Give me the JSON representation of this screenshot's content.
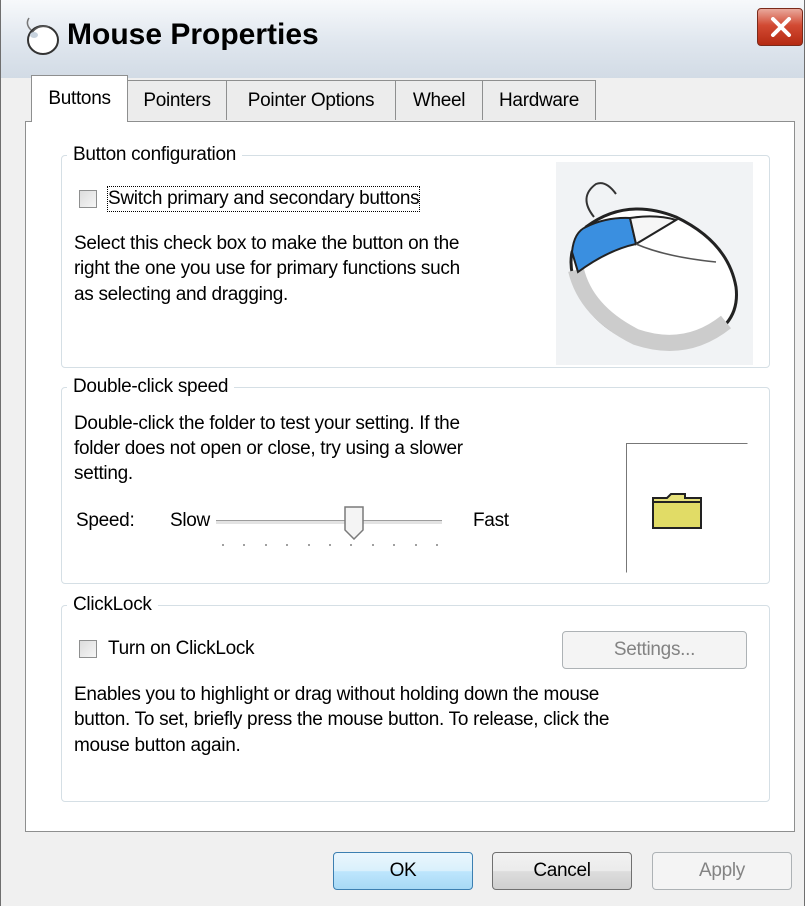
{
  "window": {
    "title": "Mouse Properties",
    "app_icon": "mouse-icon",
    "close_icon": "close-icon",
    "accent_close": "#d24a33"
  },
  "tabs": [
    {
      "label": "Buttons",
      "active": true
    },
    {
      "label": "Pointers",
      "active": false
    },
    {
      "label": "Pointer Options",
      "active": false
    },
    {
      "label": "Wheel",
      "active": false
    },
    {
      "label": "Hardware",
      "active": false
    }
  ],
  "button_config": {
    "legend": "Button configuration",
    "checkbox_label": "Switch primary and secondary buttons",
    "checked": false,
    "description_lines": [
      "Select this check box to make the button on the",
      "right the one you use for primary functions such",
      "as selecting and dragging."
    ],
    "illustration": "mouse-illustration"
  },
  "double_click": {
    "legend": "Double-click speed",
    "description_lines": [
      "Double-click the folder to test your setting. If the",
      "folder does not open or close, try using a slower",
      "setting."
    ],
    "speed_label": "Speed:",
    "slow_label": "Slow",
    "fast_label": "Fast",
    "slider_value_fraction": 0.62,
    "test_icon": "folder-icon"
  },
  "clicklock": {
    "legend": "ClickLock",
    "checkbox_label": "Turn on ClickLock",
    "checked": false,
    "settings_button": "Settings...",
    "description_lines": [
      "Enables you to highlight or drag without holding down the mouse",
      "button. To set, briefly press the mouse button. To release, click the",
      "mouse button again."
    ]
  },
  "footer": {
    "ok": "OK",
    "cancel": "Cancel",
    "apply": "Apply"
  }
}
